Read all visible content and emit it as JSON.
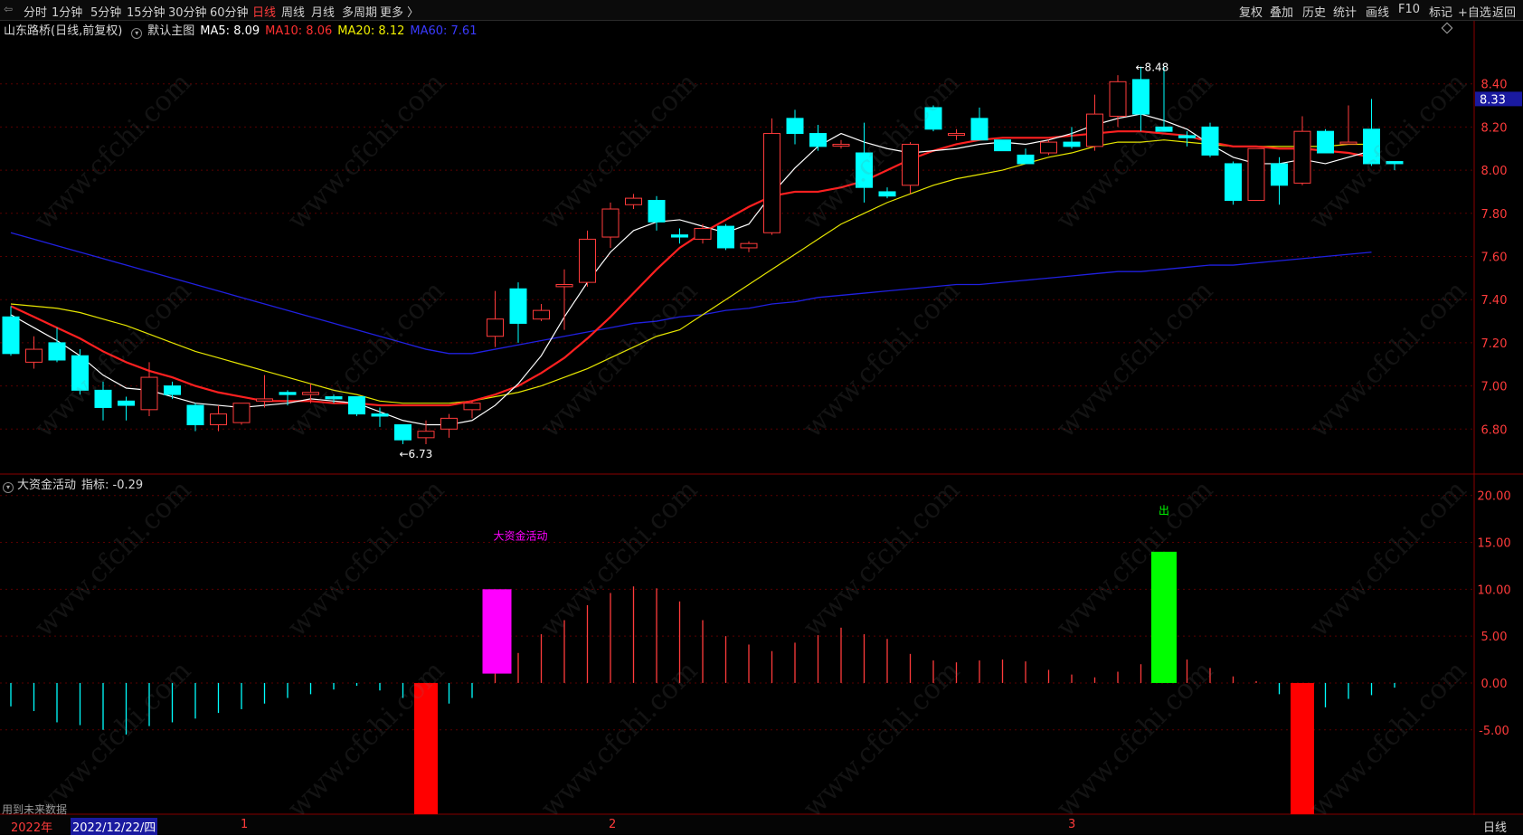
{
  "toolbar": {
    "periods": [
      "分时",
      "1分钟",
      "5分钟",
      "15分钟",
      "30分钟",
      "60分钟",
      "日线",
      "周线",
      "月线",
      "多周期",
      "更多 〉"
    ],
    "active_period": "日线",
    "right_items": [
      "复权",
      "叠加",
      "历史",
      "统计",
      "画线",
      "F10",
      "标记",
      "+自选",
      "返回"
    ]
  },
  "main_header": {
    "stock": "山东路桥(日线,前复权)",
    "template": "默认主图",
    "ma5": "MA5: 8.09",
    "ma10": "MA10: 8.06",
    "ma20": "MA20: 8.12",
    "ma60": "MA60: 7.61"
  },
  "indicator_header": {
    "name": "大资金活动",
    "value": "指标: -0.29"
  },
  "price_tag": "8.33",
  "annotations": {
    "high": "8.48",
    "low": "6.73",
    "signal_label": "大资金活动",
    "exit_label": "出"
  },
  "bottom": {
    "future_label": "用到未来数据",
    "year_label": "2022年",
    "cursor_date": "2022/12/22/四",
    "month_labels": [
      "1",
      "2",
      "3"
    ],
    "corner": "日线"
  },
  "colors": {
    "up": "#ff3b3b",
    "down": "#00ffff",
    "ma5": "#ffffff",
    "ma10": "#ff2020",
    "ma20": "#e6e600",
    "ma60": "#2020e0",
    "grid": "#5a0000",
    "magenta": "#ff00ff",
    "green": "#00ff00"
  },
  "chart_data": [
    {
      "type": "candlestick",
      "title": "山东路桥(日线,前复权)",
      "y_ticks": [
        6.8,
        7.0,
        7.2,
        7.4,
        7.6,
        7.8,
        8.0,
        8.2,
        8.4
      ],
      "ylim": [
        6.6,
        8.6
      ],
      "candles": [
        [
          7.32,
          7.37,
          7.14,
          7.15
        ],
        [
          7.11,
          7.23,
          7.08,
          7.17
        ],
        [
          7.2,
          7.27,
          7.11,
          7.12
        ],
        [
          7.14,
          7.17,
          6.96,
          6.98
        ],
        [
          6.98,
          7.02,
          6.84,
          6.9
        ],
        [
          6.93,
          6.95,
          6.84,
          6.91
        ],
        [
          6.89,
          7.11,
          6.86,
          7.04
        ],
        [
          7.0,
          7.02,
          6.94,
          6.96
        ],
        [
          6.91,
          6.92,
          6.79,
          6.82
        ],
        [
          6.82,
          6.91,
          6.79,
          6.87
        ],
        [
          6.83,
          6.92,
          6.82,
          6.92
        ],
        [
          6.93,
          7.05,
          6.9,
          6.94
        ],
        [
          6.97,
          6.98,
          6.91,
          6.96
        ],
        [
          6.96,
          7.01,
          6.92,
          6.97
        ],
        [
          6.95,
          6.96,
          6.92,
          6.94
        ],
        [
          6.95,
          6.95,
          6.86,
          6.87
        ],
        [
          6.87,
          6.9,
          6.81,
          6.86
        ],
        [
          6.82,
          6.82,
          6.73,
          6.75
        ],
        [
          6.76,
          6.84,
          6.73,
          6.79
        ],
        [
          6.8,
          6.87,
          6.76,
          6.85
        ],
        [
          6.89,
          6.93,
          6.85,
          6.92
        ],
        [
          7.23,
          7.44,
          7.18,
          7.31
        ],
        [
          7.45,
          7.48,
          7.2,
          7.29
        ],
        [
          7.31,
          7.38,
          7.3,
          7.35
        ],
        [
          7.46,
          7.54,
          7.26,
          7.47
        ],
        [
          7.48,
          7.72,
          7.46,
          7.68
        ],
        [
          7.69,
          7.85,
          7.64,
          7.82
        ],
        [
          7.84,
          7.89,
          7.82,
          7.87
        ],
        [
          7.86,
          7.88,
          7.72,
          7.76
        ],
        [
          7.7,
          7.73,
          7.66,
          7.69
        ],
        [
          7.68,
          7.75,
          7.66,
          7.73
        ],
        [
          7.74,
          7.75,
          7.63,
          7.64
        ],
        [
          7.64,
          7.67,
          7.62,
          7.66
        ],
        [
          7.71,
          8.24,
          7.7,
          8.17
        ],
        [
          8.24,
          8.28,
          8.12,
          8.17
        ],
        [
          8.17,
          8.21,
          8.09,
          8.11
        ],
        [
          8.12,
          8.14,
          8.1,
          8.12
        ],
        [
          8.08,
          8.22,
          7.85,
          7.92
        ],
        [
          7.9,
          7.92,
          7.87,
          7.88
        ],
        [
          7.93,
          8.13,
          7.89,
          8.12
        ],
        [
          8.29,
          8.3,
          8.18,
          8.19
        ],
        [
          8.17,
          8.19,
          8.14,
          8.17
        ],
        [
          8.24,
          8.29,
          8.14,
          8.14
        ],
        [
          8.14,
          8.14,
          8.09,
          8.09
        ],
        [
          8.07,
          8.1,
          8.04,
          8.03
        ],
        [
          8.08,
          8.14,
          8.07,
          8.13
        ],
        [
          8.13,
          8.2,
          8.1,
          8.11
        ],
        [
          8.11,
          8.35,
          8.09,
          8.26
        ],
        [
          8.25,
          8.44,
          8.2,
          8.41
        ],
        [
          8.42,
          8.48,
          8.18,
          8.26
        ],
        [
          8.2,
          8.48,
          8.18,
          8.18
        ],
        [
          8.16,
          8.18,
          8.11,
          8.15
        ],
        [
          8.2,
          8.22,
          8.06,
          8.07
        ],
        [
          8.03,
          8.04,
          7.84,
          7.86
        ],
        [
          7.86,
          8.09,
          7.86,
          8.1
        ],
        [
          8.03,
          8.06,
          7.84,
          7.93
        ],
        [
          7.94,
          8.25,
          7.93,
          8.18
        ],
        [
          8.18,
          8.19,
          8.11,
          8.08
        ],
        [
          8.13,
          8.3,
          8.12,
          8.13
        ],
        [
          8.19,
          8.33,
          8.02,
          8.03
        ],
        [
          8.04,
          8.04,
          8.0,
          8.03
        ]
      ],
      "ma5": [
        7.33,
        7.27,
        7.21,
        7.14,
        7.05,
        6.99,
        6.98,
        6.95,
        6.92,
        6.91,
        6.9,
        6.91,
        6.92,
        6.94,
        6.93,
        6.92,
        6.88,
        6.84,
        6.82,
        6.82,
        6.84,
        6.91,
        7.01,
        7.14,
        7.32,
        7.48,
        7.62,
        7.72,
        7.76,
        7.77,
        7.74,
        7.71,
        7.75,
        7.89,
        8.01,
        8.11,
        8.17,
        8.13,
        8.1,
        8.08,
        8.09,
        8.1,
        8.12,
        8.13,
        8.12,
        8.14,
        8.17,
        8.21,
        8.24,
        8.26,
        8.23,
        8.19,
        8.12,
        8.06,
        8.03,
        8.03,
        8.05,
        8.03,
        8.06,
        8.09
      ],
      "ma10": [
        7.37,
        7.32,
        7.27,
        7.22,
        7.16,
        7.11,
        7.07,
        7.04,
        7.0,
        6.97,
        6.95,
        6.93,
        6.93,
        6.93,
        6.92,
        6.92,
        6.91,
        6.91,
        6.91,
        6.91,
        6.93,
        6.96,
        7.0,
        7.06,
        7.13,
        7.22,
        7.32,
        7.43,
        7.54,
        7.64,
        7.71,
        7.77,
        7.83,
        7.88,
        7.9,
        7.9,
        7.92,
        7.95,
        8.0,
        8.05,
        8.09,
        8.12,
        8.14,
        8.15,
        8.15,
        8.15,
        8.16,
        8.17,
        8.18,
        8.18,
        8.17,
        8.16,
        8.13,
        8.11,
        8.11,
        8.1,
        8.1,
        8.09,
        8.08,
        8.06
      ],
      "ma20": [
        7.38,
        7.37,
        7.36,
        7.34,
        7.31,
        7.28,
        7.24,
        7.2,
        7.16,
        7.13,
        7.1,
        7.07,
        7.04,
        7.01,
        6.98,
        6.96,
        6.93,
        6.92,
        6.92,
        6.92,
        6.93,
        6.95,
        6.97,
        7.0,
        7.04,
        7.08,
        7.13,
        7.18,
        7.23,
        7.26,
        7.33,
        7.4,
        7.47,
        7.54,
        7.61,
        7.68,
        7.75,
        7.8,
        7.85,
        7.89,
        7.93,
        7.96,
        7.98,
        8.0,
        8.03,
        8.06,
        8.08,
        8.11,
        8.13,
        8.13,
        8.14,
        8.13,
        8.12,
        8.11,
        8.11,
        8.11,
        8.11,
        8.11,
        8.12,
        8.12
      ],
      "ma60": [
        7.71,
        7.68,
        7.65,
        7.62,
        7.59,
        7.56,
        7.53,
        7.5,
        7.47,
        7.44,
        7.41,
        7.38,
        7.35,
        7.32,
        7.29,
        7.26,
        7.23,
        7.2,
        7.17,
        7.15,
        7.15,
        7.17,
        7.19,
        7.21,
        7.23,
        7.25,
        7.27,
        7.29,
        7.3,
        7.32,
        7.33,
        7.35,
        7.36,
        7.38,
        7.39,
        7.41,
        7.42,
        7.43,
        7.44,
        7.45,
        7.46,
        7.47,
        7.47,
        7.48,
        7.49,
        7.5,
        7.51,
        7.52,
        7.53,
        7.53,
        7.54,
        7.55,
        7.56,
        7.56,
        7.57,
        7.58,
        7.59,
        7.6,
        7.61,
        7.62
      ]
    },
    {
      "type": "bar",
      "title": "大资金活动",
      "y_ticks": [
        -5.0,
        0.0,
        5.0,
        10.0,
        15.0,
        20.0
      ],
      "ylim": [
        -14.0,
        22.0
      ],
      "values": [
        -2.5,
        -3.0,
        -4.2,
        -4.5,
        -5.0,
        -5.5,
        -4.6,
        -4.2,
        -3.8,
        -3.2,
        -2.8,
        -2.2,
        -1.6,
        -1.2,
        -0.7,
        -0.3,
        -0.8,
        -1.6,
        -14.0,
        -2.2,
        -1.6,
        1.0,
        3.2,
        5.2,
        6.7,
        8.3,
        9.6,
        10.3,
        10.1,
        8.7,
        6.7,
        5.0,
        4.1,
        3.4,
        4.3,
        5.1,
        5.9,
        5.2,
        4.7,
        3.1,
        2.4,
        2.2,
        2.4,
        2.5,
        2.3,
        1.4,
        0.9,
        0.6,
        1.2,
        2.0,
        14.0,
        2.5,
        1.6,
        0.7,
        0.2,
        -1.2,
        -14.0,
        -2.6,
        -1.7,
        -1.3,
        -0.5,
        -0.4,
        -0.3
      ],
      "magenta_box": [
        1.0,
        10.0
      ],
      "green_box": [
        0.0,
        14.0
      ],
      "red_boxes": [
        [
          -14.0,
          0.0
        ],
        [
          -14.0,
          0.0
        ]
      ]
    }
  ]
}
